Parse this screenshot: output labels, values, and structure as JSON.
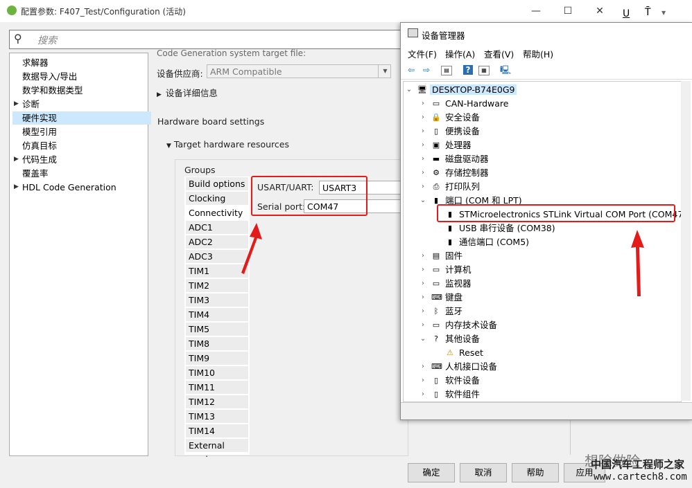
{
  "config_window": {
    "title": "配置参数: F407_Test/Configuration (活动)",
    "minimize": "—",
    "maximize": "☐",
    "close": "✕",
    "search_placeholder": "搜索",
    "tree": [
      {
        "label": "求解器",
        "expandable": false
      },
      {
        "label": "数据导入/导出",
        "expandable": false
      },
      {
        "label": "数学和数据类型",
        "expandable": false
      },
      {
        "label": "诊断",
        "expandable": true
      },
      {
        "label": "硬件实现",
        "expandable": false,
        "selected": true
      },
      {
        "label": "模型引用",
        "expandable": false
      },
      {
        "label": "仿真目标",
        "expandable": false
      },
      {
        "label": "代码生成",
        "expandable": true
      },
      {
        "label": "覆盖率",
        "expandable": false
      },
      {
        "label": "HDL Code Generation",
        "expandable": true
      }
    ],
    "partial_top_text": "Code Generation system target file:",
    "vendor_label": "设备供应商:",
    "vendor_value": "ARM Compatible",
    "device_details": "设备详细信息",
    "hw_board_settings": "Hardware board settings",
    "target_hw_resources": "Target hardware resources",
    "groups_label": "Groups",
    "groups": [
      "Build options",
      "Clocking",
      "Connectivity",
      "ADC1",
      "ADC2",
      "ADC3",
      "TIM1",
      "TIM2",
      "TIM3",
      "TIM4",
      "TIM5",
      "TIM8",
      "TIM9",
      "TIM10",
      "TIM11",
      "TIM12",
      "TIM13",
      "TIM14",
      "External mode"
    ],
    "selected_group": "Connectivity",
    "usart_label": "USART/UART:",
    "usart_value": "USART3",
    "serial_label": "Serial port:",
    "serial_value": "COM47",
    "buttons": {
      "ok": "确定",
      "cancel": "取消",
      "help": "帮助",
      "apply": "应用"
    }
  },
  "device_manager": {
    "title": "设备管理器",
    "menu": [
      "文件(F)",
      "操作(A)",
      "查看(V)",
      "帮助(H)"
    ],
    "root": "DESKTOP-B74E0G9",
    "nodes": [
      {
        "label": "CAN-Hardware",
        "icon": "▭",
        "expanded": false
      },
      {
        "label": "安全设备",
        "icon": "🔒",
        "expanded": false
      },
      {
        "label": "便携设备",
        "icon": "▯",
        "expanded": false
      },
      {
        "label": "处理器",
        "icon": "▣",
        "expanded": false
      },
      {
        "label": "磁盘驱动器",
        "icon": "▬",
        "expanded": false
      },
      {
        "label": "存储控制器",
        "icon": "⚙",
        "expanded": false
      },
      {
        "label": "打印队列",
        "icon": "⎙",
        "expanded": false
      },
      {
        "label": "端口 (COM 和 LPT)",
        "icon": "▮",
        "expanded": true,
        "children": [
          {
            "label": "STMicroelectronics STLink Virtual COM Port (COM47)",
            "icon": "▮"
          },
          {
            "label": "USB 串行设备 (COM38)",
            "icon": "▮"
          },
          {
            "label": "通信端口 (COM5)",
            "icon": "▮"
          }
        ]
      },
      {
        "label": "固件",
        "icon": "▤",
        "expanded": false
      },
      {
        "label": "计算机",
        "icon": "▭",
        "expanded": false
      },
      {
        "label": "监视器",
        "icon": "▭",
        "expanded": false
      },
      {
        "label": "键盘",
        "icon": "⌨",
        "expanded": false
      },
      {
        "label": "蓝牙",
        "icon": "ᛒ",
        "expanded": false
      },
      {
        "label": "内存技术设备",
        "icon": "▭",
        "expanded": false
      },
      {
        "label": "其他设备",
        "icon": "?",
        "expanded": true,
        "children": [
          {
            "label": "Reset",
            "icon": "⚠"
          }
        ]
      },
      {
        "label": "人机接口设备",
        "icon": "⌨",
        "expanded": false
      },
      {
        "label": "软件设备",
        "icon": "▯",
        "expanded": false
      },
      {
        "label": "软件组件",
        "icon": "▯",
        "expanded": false
      }
    ]
  },
  "watermark": {
    "line1": "想除做险",
    "line2": "中国汽车工程师之家",
    "line3": "www.cartech8.com"
  },
  "colors": {
    "highlight_red": "#e31b1b",
    "selection_blue": "#cce8ff"
  }
}
